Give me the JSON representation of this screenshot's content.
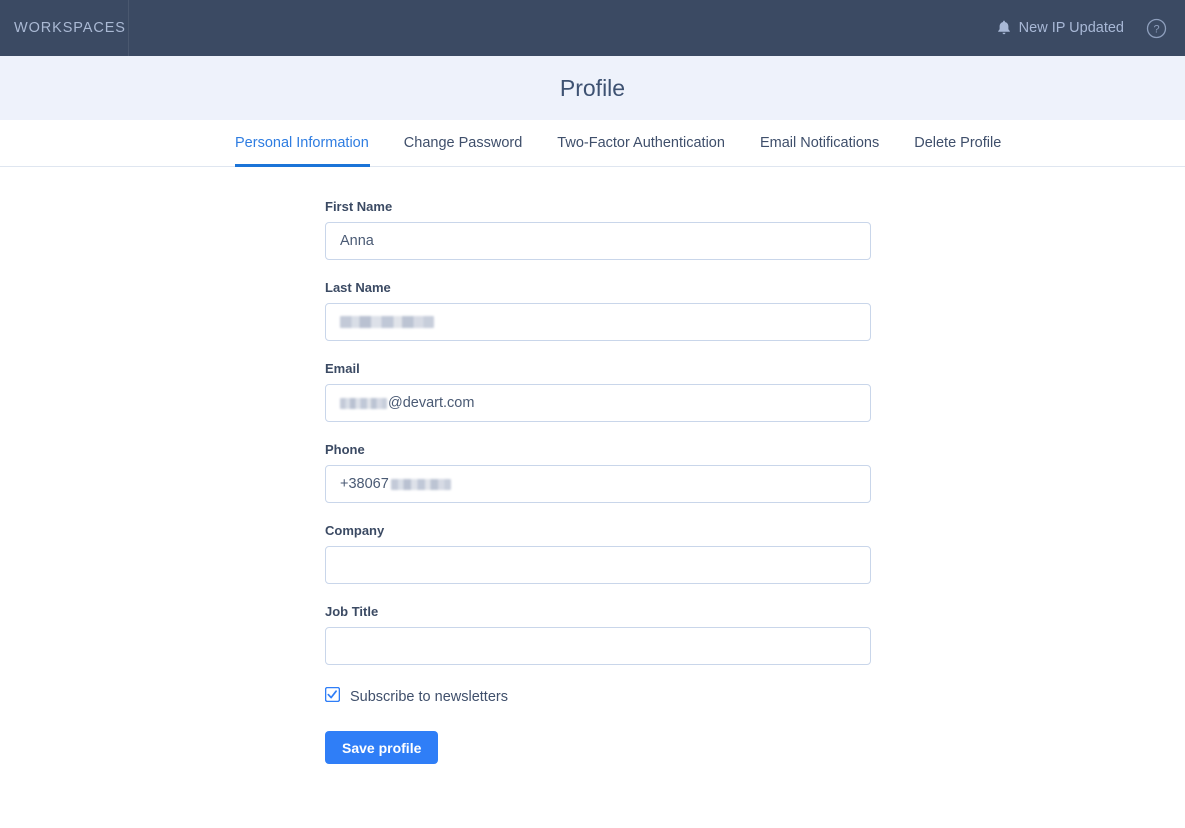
{
  "topbar": {
    "brand": "WORKSPACES",
    "notification": {
      "icon": "bell-icon",
      "label": "New IP Updated"
    },
    "help": {
      "icon": "help-circle-icon",
      "label": "?"
    },
    "background_color": "#3b4a63",
    "brand_color": "#aab9d4"
  },
  "header": {
    "title": "Profile",
    "background_color": "#eef2fb"
  },
  "tabs": [
    {
      "label": "Personal Information",
      "active": true
    },
    {
      "label": "Change Password",
      "active": false
    },
    {
      "label": "Two-Factor Authentication",
      "active": false
    },
    {
      "label": "Email Notifications",
      "active": false
    },
    {
      "label": "Delete Profile",
      "active": false
    }
  ],
  "tab_accent_color": "#1b74d8",
  "form": {
    "fields": [
      {
        "label": "First Name",
        "value": "Anna",
        "placeholder": "",
        "redacted": "none"
      },
      {
        "label": "Last Name",
        "value": "",
        "placeholder": "",
        "redacted": "full"
      },
      {
        "label": "Email",
        "value": "@devart.com",
        "placeholder": "",
        "redacted": "prefix"
      },
      {
        "label": "Phone",
        "value": "+38067",
        "placeholder": "",
        "redacted": "suffix"
      },
      {
        "label": "Company",
        "value": "",
        "placeholder": "",
        "redacted": "none"
      },
      {
        "label": "Job Title",
        "value": "",
        "placeholder": "",
        "redacted": "none"
      }
    ],
    "checkbox": {
      "label": "Subscribe to newsletters",
      "checked": true
    },
    "submit_label": "Save profile",
    "submit_color": "#2f7ef7"
  }
}
